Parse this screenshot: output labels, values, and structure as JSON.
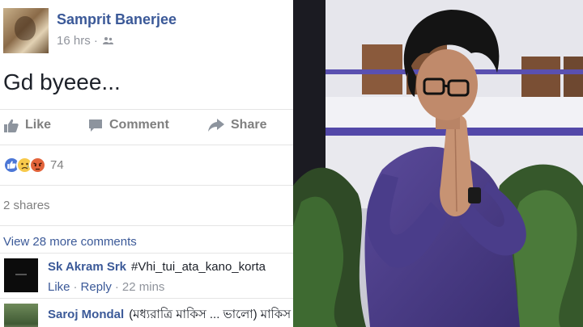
{
  "post": {
    "author": "Samprit Banerjee",
    "time": "16 hrs",
    "text": "Gd byeee..."
  },
  "actions": {
    "like": "Like",
    "comment": "Comment",
    "share": "Share"
  },
  "reactions": {
    "types": [
      "like",
      "sad",
      "angry"
    ],
    "count": "74"
  },
  "shares": "2 shares",
  "more_comments": "View 28 more comments",
  "comments": [
    {
      "name": "Sk Akram Srk",
      "text": "#Vhi_tui_ata_kano_korta",
      "like": "Like",
      "reply": "Reply",
      "time": "22 mins"
    },
    {
      "name": "Saroj Mondal",
      "text": "(মধ্যরাত্রি মাকিস ... ভালো) মাকিস"
    }
  ],
  "colors": {
    "link": "#3b5998",
    "meta": "#90949c",
    "action": "#7f7f7f",
    "divider": "#e5e5e5"
  }
}
